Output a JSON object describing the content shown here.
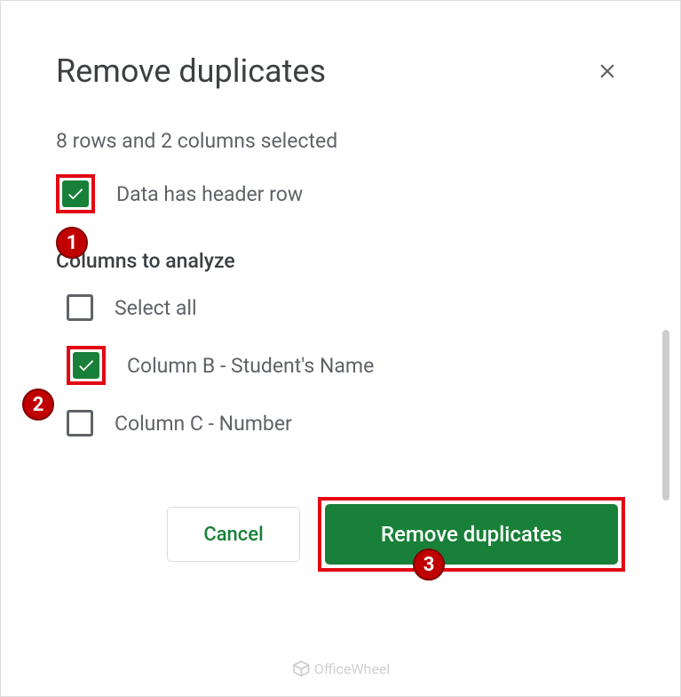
{
  "dialog": {
    "title": "Remove duplicates",
    "selection_info": "8 rows and 2 columns selected",
    "header_checkbox_label": "Data has header row",
    "section_title": "Columns to analyze",
    "select_all_label": "Select all",
    "columns": [
      {
        "label": "Column B - Student's Name",
        "checked": true
      },
      {
        "label": "Column C - Number",
        "checked": false
      }
    ],
    "cancel_label": "Cancel",
    "confirm_label": "Remove duplicates"
  },
  "callouts": {
    "c1": "1",
    "c2": "2",
    "c3": "3"
  },
  "watermark": "OfficeWheel"
}
